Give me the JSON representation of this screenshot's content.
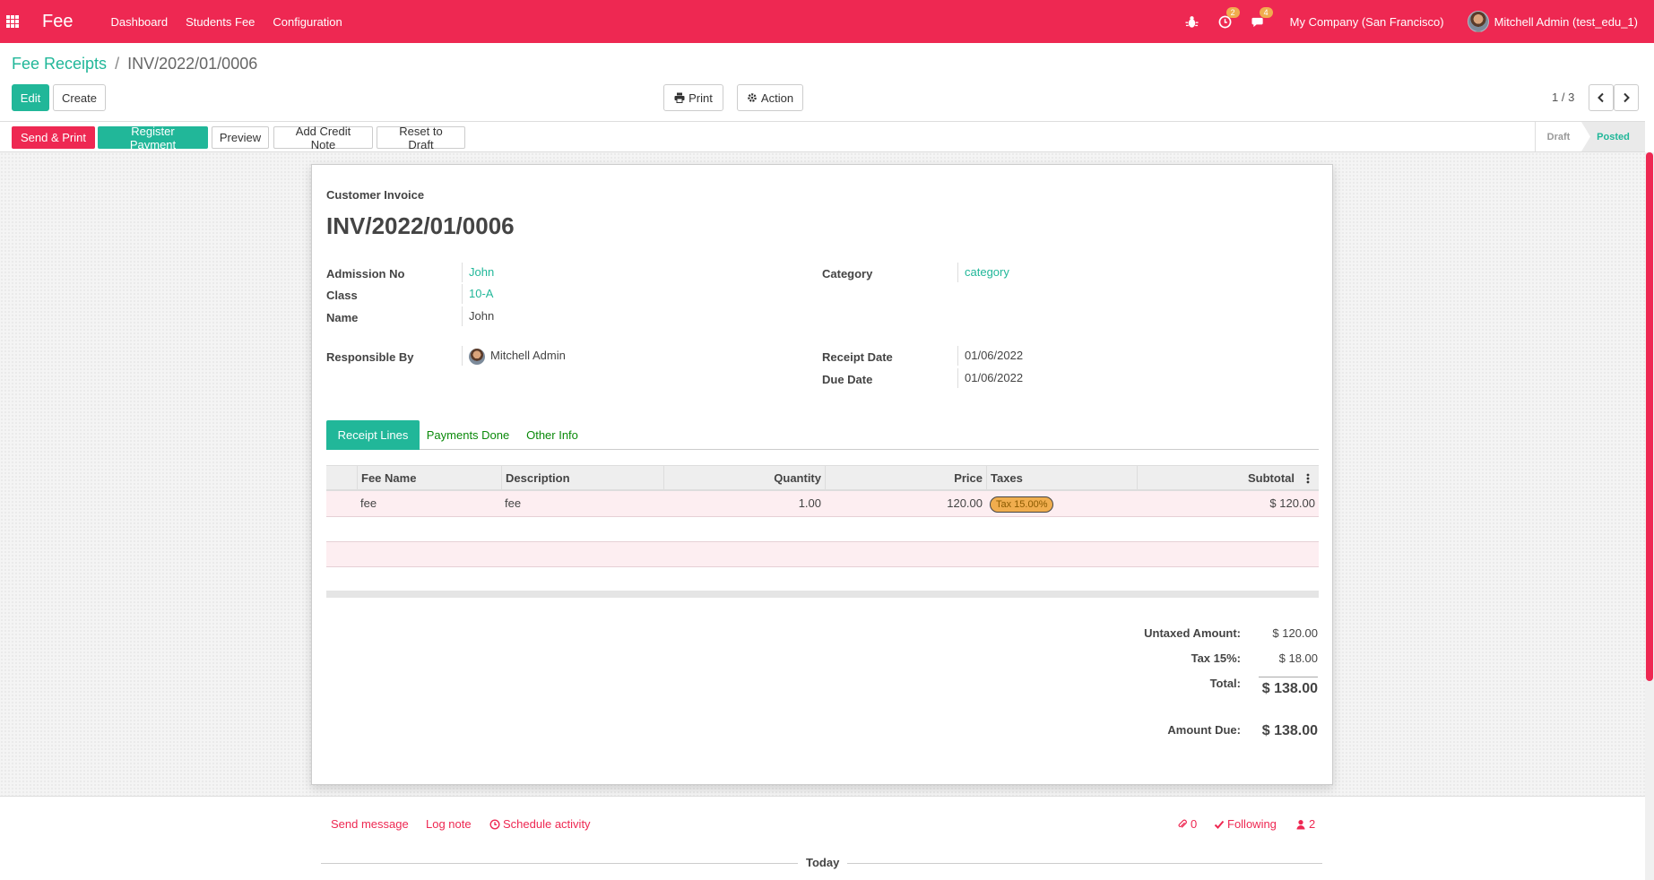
{
  "navbar": {
    "brand": "Fee",
    "menu": [
      "Dashboard",
      "Students Fee",
      "Configuration"
    ],
    "activity_badge": "2",
    "messages_badge": "4",
    "company": "My Company (San Francisco)",
    "user": "Mitchell Admin (test_edu_1)"
  },
  "breadcrumb": {
    "parent": "Fee Receipts",
    "separator": "/",
    "current": "INV/2022/01/0006"
  },
  "toolbar": {
    "edit": "Edit",
    "create": "Create",
    "print": "Print",
    "action": "Action",
    "pager": "1 / 3"
  },
  "statusbar": {
    "buttons": [
      "Send & Print",
      "Register Payment",
      "Preview",
      "Add Credit Note",
      "Reset to Draft"
    ],
    "stages": [
      "Draft",
      "Posted"
    ],
    "active_stage": "Posted"
  },
  "form": {
    "doc_type": "Customer Invoice",
    "number": "INV/2022/01/0006",
    "left_fields": [
      {
        "label": "Admission No",
        "value": "John"
      },
      {
        "label": "Class",
        "value": "10-A"
      },
      {
        "label": "Name",
        "value": "John"
      }
    ],
    "right_fields": [
      {
        "label": "Category",
        "value": "category"
      }
    ],
    "responsible": {
      "label": "Responsible By",
      "value": "Mitchell Admin"
    },
    "dates": [
      {
        "label": "Receipt Date",
        "value": "01/06/2022"
      },
      {
        "label": "Due Date",
        "value": "01/06/2022"
      }
    ]
  },
  "tabs": [
    "Receipt Lines",
    "Payments Done",
    "Other Info"
  ],
  "lines": {
    "headers": [
      "Fee Name",
      "Description",
      "Quantity",
      "Price",
      "Taxes",
      "Subtotal"
    ],
    "rows": [
      {
        "fee_name": "fee",
        "description": "fee",
        "quantity": "1.00",
        "price": "120.00",
        "tax": "Tax 15.00%",
        "subtotal": "$ 120.00"
      }
    ]
  },
  "totals": {
    "untaxed_label": "Untaxed Amount:",
    "untaxed": "$ 120.00",
    "tax_label": "Tax 15%:",
    "tax": "$ 18.00",
    "total_label": "Total:",
    "total": "$ 138.00",
    "due_label": "Amount Due:",
    "due": "$ 138.00"
  },
  "chatter": {
    "send_message": "Send message",
    "log_note": "Log note",
    "schedule": "Schedule activity",
    "attachments": "0",
    "following": "Following",
    "followers": "2",
    "today": "Today"
  },
  "colors": {
    "brand": "#ee2852",
    "accent": "#21b799"
  }
}
